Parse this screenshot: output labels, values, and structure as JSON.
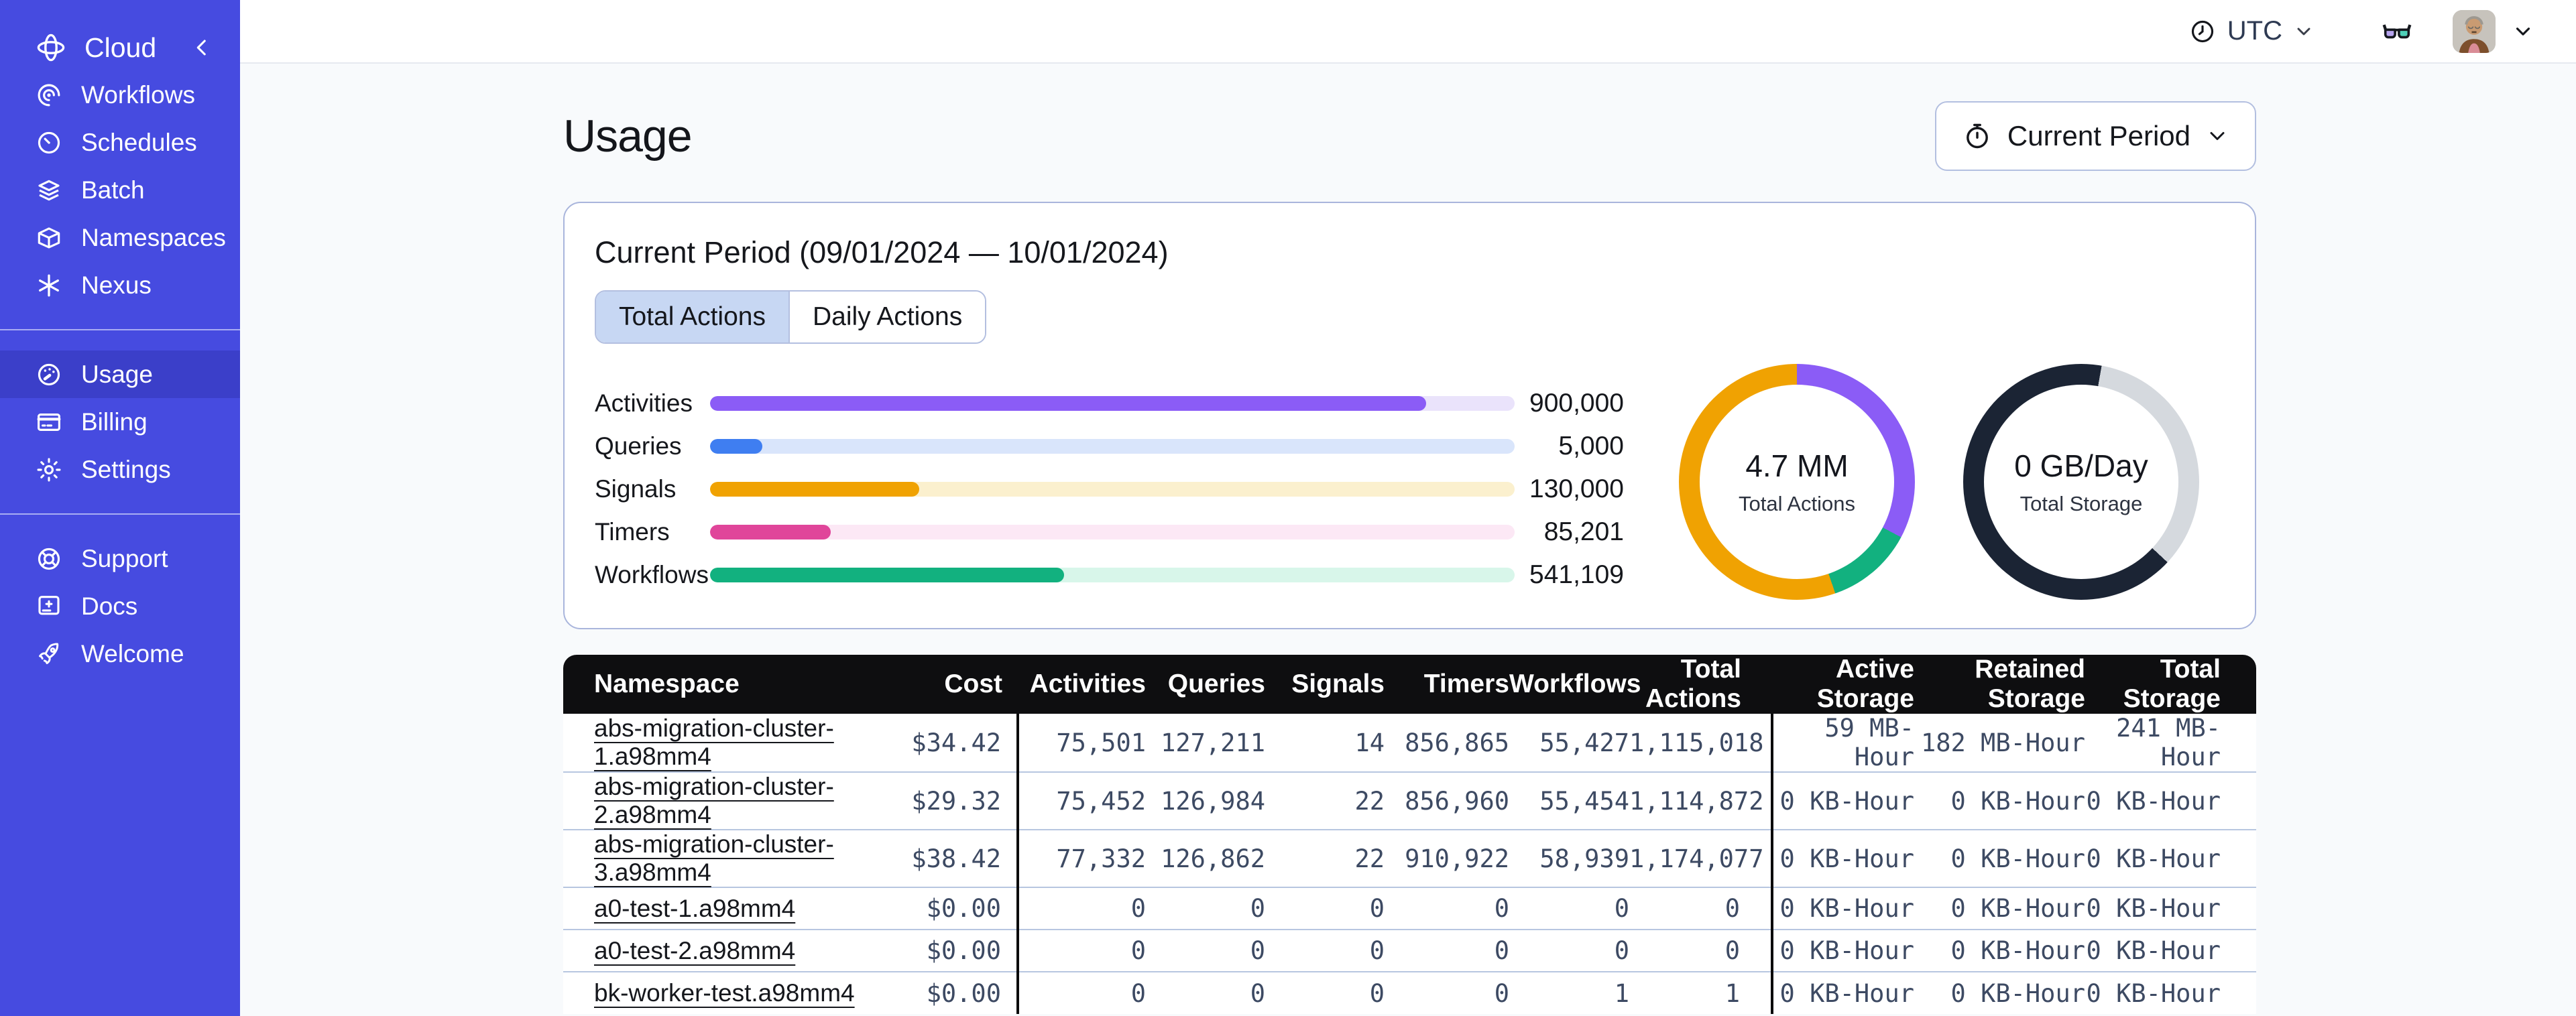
{
  "sidebar": {
    "brand": "Cloud",
    "groups": [
      {
        "items": [
          {
            "label": "Workflows",
            "icon": "workflows-icon"
          },
          {
            "label": "Schedules",
            "icon": "schedules-icon"
          },
          {
            "label": "Batch",
            "icon": "batch-icon"
          },
          {
            "label": "Namespaces",
            "icon": "namespaces-icon"
          },
          {
            "label": "Nexus",
            "icon": "nexus-icon"
          }
        ]
      },
      {
        "items": [
          {
            "label": "Usage",
            "icon": "usage-gauge-icon",
            "active": true
          },
          {
            "label": "Billing",
            "icon": "billing-card-icon"
          },
          {
            "label": "Settings",
            "icon": "settings-gear-icon"
          }
        ]
      },
      {
        "items": [
          {
            "label": "Support",
            "icon": "support-buoy-icon"
          },
          {
            "label": "Docs",
            "icon": "docs-icon"
          },
          {
            "label": "Welcome",
            "icon": "welcome-rocket-icon"
          }
        ]
      }
    ]
  },
  "topbar": {
    "timezone": "UTC"
  },
  "page": {
    "title": "Usage",
    "period_selector": "Current Period"
  },
  "usage_card": {
    "title": "Current Period (09/01/2024 — 10/01/2024)",
    "tabs": [
      "Total Actions",
      "Daily Actions"
    ]
  },
  "chart_data": [
    {
      "type": "bar",
      "orientation": "horizontal",
      "rows": [
        {
          "label": "Activities",
          "value": 900000,
          "value_label": "900,000",
          "fill_pct": 89,
          "color": "#8b5cf6",
          "track_color": "#eae3fb"
        },
        {
          "label": "Queries",
          "value": 5000,
          "value_label": "5,000",
          "fill_pct": 6.5,
          "color": "#3f7ef1",
          "track_color": "#d9e5fb"
        },
        {
          "label": "Signals",
          "value": 130000,
          "value_label": "130,000",
          "fill_pct": 26,
          "color": "#f0a202",
          "track_color": "#fbf0ce"
        },
        {
          "label": "Timers",
          "value": 85201,
          "value_label": "85,201",
          "fill_pct": 15,
          "color": "#e0459a",
          "track_color": "#fce8f5"
        },
        {
          "label": "Workflows",
          "value": 541109,
          "value_label": "541,109",
          "fill_pct": 44,
          "color": "#12b17f",
          "track_color": "#d8f6ea"
        }
      ]
    },
    {
      "type": "donut",
      "center_value": "4.7 MM",
      "center_label": "Total Actions",
      "segments": [
        {
          "name": "activities",
          "color": "#8b5cf6",
          "from_deg": 0,
          "to_deg": 118
        },
        {
          "name": "workflows",
          "color": "#12b17f",
          "from_deg": 118,
          "to_deg": 161
        },
        {
          "name": "signals",
          "color": "#f0a202",
          "from_deg": 161,
          "to_deg": 360
        }
      ]
    },
    {
      "type": "donut",
      "center_value": "0 GB/Day",
      "center_label": "Total Storage",
      "segments": [
        {
          "name": "dark",
          "color": "#1b2434",
          "from_deg": 0,
          "to_deg": 10
        },
        {
          "name": "gray",
          "color": "#d5d9de",
          "from_deg": 10,
          "to_deg": 133
        },
        {
          "name": "dark2",
          "color": "#1b2434",
          "from_deg": 133,
          "to_deg": 360
        }
      ]
    }
  ],
  "table": {
    "columns": [
      "Namespace",
      "Cost",
      "Activities",
      "Queries",
      "Signals",
      "Timers",
      "Workflows",
      "Total Actions",
      "Active Storage",
      "Retained Storage",
      "Total Storage"
    ],
    "rows": [
      {
        "namespace": "abs-migration-cluster-1.a98mm4",
        "cost": "$34.42",
        "activities": "75,501",
        "queries": "127,211",
        "signals": "14",
        "timers": "856,865",
        "workflows": "55,427",
        "total_actions": "1,115,018",
        "active_storage": "59 MB-Hour",
        "retained_storage": "182 MB-Hour",
        "total_storage": "241 MB-Hour"
      },
      {
        "namespace": "abs-migration-cluster-2.a98mm4",
        "cost": "$29.32",
        "activities": "75,452",
        "queries": "126,984",
        "signals": "22",
        "timers": "856,960",
        "workflows": "55,454",
        "total_actions": "1,114,872",
        "active_storage": "0 KB-Hour",
        "retained_storage": "0 KB-Hour",
        "total_storage": "0 KB-Hour"
      },
      {
        "namespace": "abs-migration-cluster-3.a98mm4",
        "cost": "$38.42",
        "activities": "77,332",
        "queries": "126,862",
        "signals": "22",
        "timers": "910,922",
        "workflows": "58,939",
        "total_actions": "1,174,077",
        "active_storage": "0 KB-Hour",
        "retained_storage": "0 KB-Hour",
        "total_storage": "0 KB-Hour"
      },
      {
        "namespace": "a0-test-1.a98mm4",
        "cost": "$0.00",
        "activities": "0",
        "queries": "0",
        "signals": "0",
        "timers": "0",
        "workflows": "0",
        "total_actions": "0",
        "active_storage": "0 KB-Hour",
        "retained_storage": "0 KB-Hour",
        "total_storage": "0 KB-Hour"
      },
      {
        "namespace": "a0-test-2.a98mm4",
        "cost": "$0.00",
        "activities": "0",
        "queries": "0",
        "signals": "0",
        "timers": "0",
        "workflows": "0",
        "total_actions": "0",
        "active_storage": "0 KB-Hour",
        "retained_storage": "0 KB-Hour",
        "total_storage": "0 KB-Hour"
      },
      {
        "namespace": "bk-worker-test.a98mm4",
        "cost": "$0.00",
        "activities": "0",
        "queries": "0",
        "signals": "0",
        "timers": "0",
        "workflows": "1",
        "total_actions": "1",
        "active_storage": "0 KB-Hour",
        "retained_storage": "0 KB-Hour",
        "total_storage": "0 KB-Hour"
      }
    ]
  },
  "colors": {
    "sidebar_bg": "#464BE0",
    "sidebar_active": "#3B3FC9",
    "accent_border": "#a9b5dc",
    "tab_active_bg": "#c7d7f3",
    "table_header_bg": "#0e0e10",
    "row_separator": "#b7c6e0",
    "glasses_left_lens": "#b7a4ef",
    "glasses_right_lens": "#4ed0b8"
  }
}
